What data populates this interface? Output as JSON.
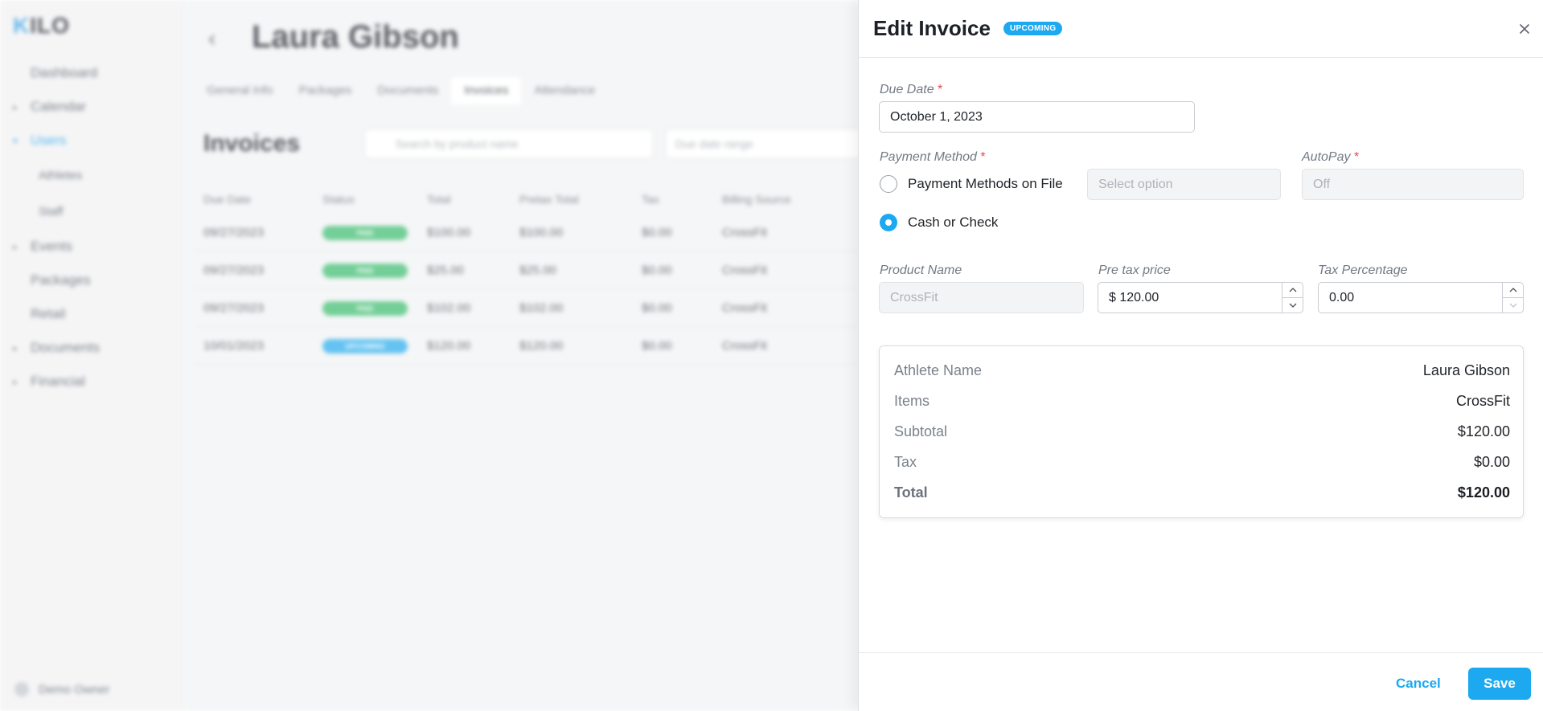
{
  "background": {
    "logo": "KILO",
    "nav": [
      {
        "label": "Dashboard",
        "caret": "",
        "sub": false,
        "active": false
      },
      {
        "label": "Calendar",
        "caret": "▸",
        "sub": false,
        "active": false
      },
      {
        "label": "Users",
        "caret": "▾",
        "sub": false,
        "active": true
      },
      {
        "label": "Athletes",
        "caret": "",
        "sub": true,
        "active": false
      },
      {
        "label": "Staff",
        "caret": "",
        "sub": true,
        "active": false
      },
      {
        "label": "Events",
        "caret": "▸",
        "sub": false,
        "active": false
      },
      {
        "label": "Packages",
        "caret": "",
        "sub": false,
        "active": false
      },
      {
        "label": "Retail",
        "caret": "",
        "sub": false,
        "active": false
      },
      {
        "label": "Documents",
        "caret": "▸",
        "sub": false,
        "active": false
      },
      {
        "label": "Financial",
        "caret": "▸",
        "sub": false,
        "active": false
      }
    ],
    "user_name": "Demo Owner",
    "person_name": "Laura Gibson",
    "tabs": [
      "General Info",
      "Packages",
      "Documents",
      "Invoices",
      "Attendance"
    ],
    "active_tab": "Invoices",
    "section_title": "Invoices",
    "search_placeholder": "Search by product name",
    "date_range_placeholder": "Due date range",
    "table_headers": [
      "Due Date",
      "Status",
      "Total",
      "Pretax Total",
      "Tax",
      "Billing Source"
    ],
    "rows": [
      {
        "due": "09/27/2023",
        "status": "PAID",
        "status_kind": "paid",
        "total": "$100.00",
        "pretax": "$100.00",
        "tax": "$0.00",
        "source": "CrossFit"
      },
      {
        "due": "09/27/2023",
        "status": "PAID",
        "status_kind": "paid",
        "total": "$25.00",
        "pretax": "$25.00",
        "tax": "$0.00",
        "source": "CrossFit"
      },
      {
        "due": "09/27/2023",
        "status": "PAID",
        "status_kind": "paid",
        "total": "$102.00",
        "pretax": "$102.00",
        "tax": "$0.00",
        "source": "CrossFit"
      },
      {
        "due": "10/01/2023",
        "status": "UPCOMING",
        "status_kind": "upcoming",
        "total": "$120.00",
        "pretax": "$120.00",
        "tax": "$0.00",
        "source": "CrossFit"
      }
    ]
  },
  "drawer": {
    "title": "Edit Invoice",
    "badge": "UPCOMING",
    "due_date_label": "Due Date",
    "due_date_value": "October 1, 2023",
    "payment_method_label": "Payment Method",
    "payment_options": [
      {
        "label": "Payment Methods on File",
        "selected": false
      },
      {
        "label": "Cash or Check",
        "selected": true
      }
    ],
    "select_placeholder": "Select option",
    "autopay_label": "AutoPay",
    "autopay_value": "Off",
    "product_name_label": "Product Name",
    "product_name_value": "CrossFit",
    "pretax_label": "Pre tax price",
    "pretax_value": "$ 120.00",
    "tax_pct_label": "Tax Percentage",
    "tax_pct_value": "0.00",
    "summary": [
      {
        "key": "Athlete Name",
        "value": "Laura Gibson"
      },
      {
        "key": "Items",
        "value": "CrossFit"
      },
      {
        "key": "Subtotal",
        "value": "$120.00"
      },
      {
        "key": "Tax",
        "value": "$0.00"
      },
      {
        "key": "Total",
        "value": "$120.00"
      }
    ],
    "cancel_label": "Cancel",
    "save_label": "Save"
  },
  "colors": {
    "accent": "#1da9ef",
    "required": "#e5484d",
    "paid": "#4cc27a"
  }
}
